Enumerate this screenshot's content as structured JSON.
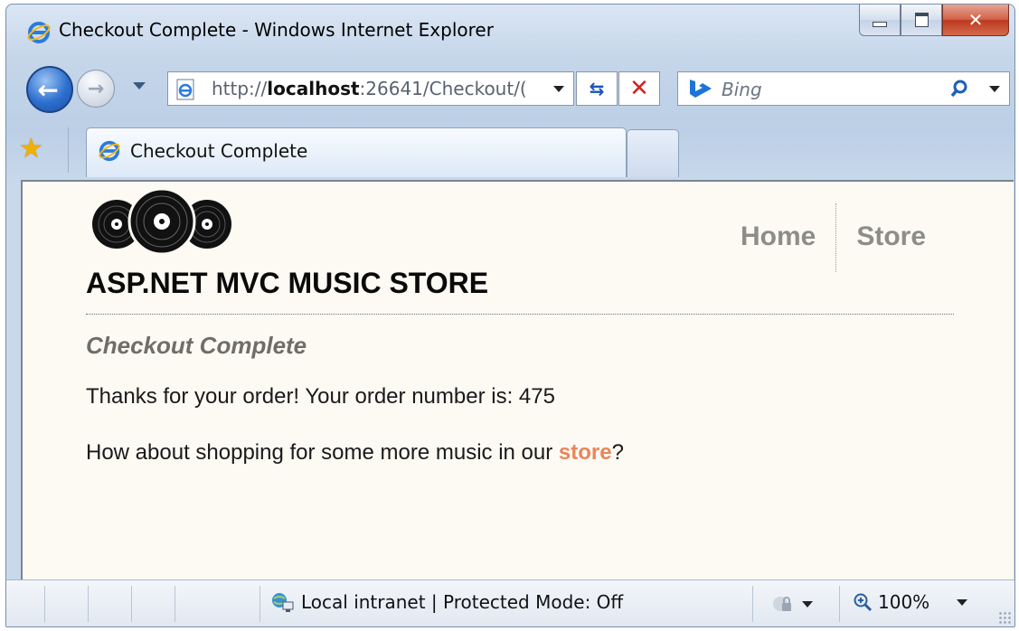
{
  "window": {
    "title": "Checkout Complete - Windows Internet Explorer"
  },
  "address_bar": {
    "prefix": "http://",
    "host": "localhost",
    "rest": ":26641/Checkout/("
  },
  "search": {
    "placeholder": "Bing"
  },
  "tabs": [
    {
      "label": "Checkout Complete"
    }
  ],
  "site": {
    "title": "ASP.NET MVC MUSIC STORE",
    "nav": [
      {
        "label": "Home"
      },
      {
        "label": "Store"
      }
    ]
  },
  "page": {
    "heading": "Checkout Complete",
    "order_text": "Thanks for your order! Your order number is: 475",
    "shop_prefix": "How about shopping for some more music in our ",
    "shop_link": "store",
    "shop_suffix": "?"
  },
  "status": {
    "zone": "Local intranet | Protected Mode: Off",
    "zoom": "100%"
  },
  "colors": {
    "link": "#e9855c",
    "content_bg": "#fcfaf2",
    "nav_text": "#8d8d88"
  }
}
